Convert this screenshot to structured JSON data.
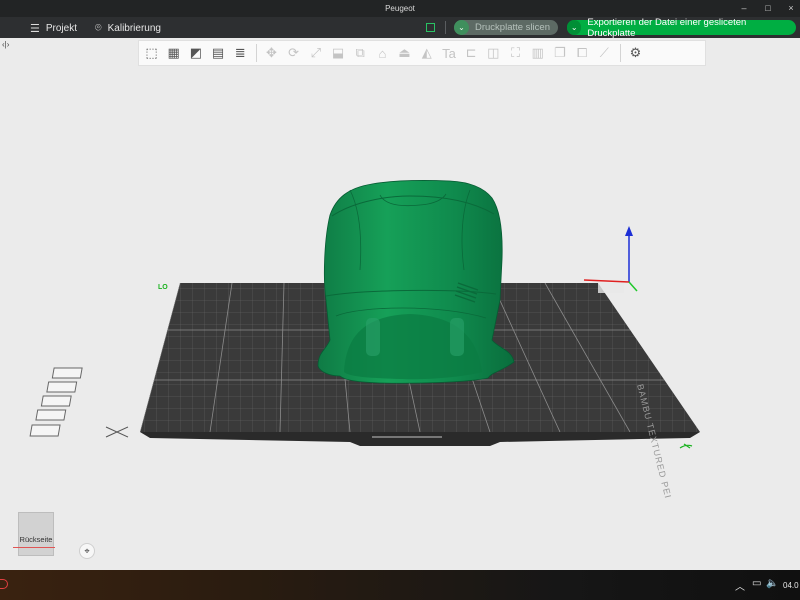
{
  "window": {
    "title": "Peugeot",
    "controls": [
      "minimize",
      "maximize",
      "close"
    ]
  },
  "menu": {
    "project_label": "Projekt",
    "calibration_label": "Kalibrierung"
  },
  "actions": {
    "slice_label": "Druckplatte slicen",
    "export_label": "Exportieren der Datei einer gesliceten Druckplatte"
  },
  "toolbar": {
    "tools": [
      "add-object-icon",
      "grid-arrange-icon",
      "orient-icon",
      "plate-icon",
      "layers-icon",
      "move-icon",
      "rotate-icon",
      "scale-icon",
      "lay-on-face-icon",
      "cut-icon",
      "support-paint-icon",
      "seam-paint-icon",
      "color-paint-icon",
      "text-icon",
      "measure-icon",
      "assembly-icon",
      "mesh-boolean-icon",
      "variable-layer-icon",
      "split-objects-icon",
      "split-parts-icon",
      "ruler-icon",
      "settings-icon"
    ]
  },
  "viewport": {
    "plate_label": "BAMBU TEXTURED PEI",
    "plate_corner_mark": "LO",
    "model_color": "#0b8a4e",
    "plate_color": "#3a3a3a",
    "view_cube_label": "Rückseite"
  },
  "colors": {
    "accent": "#00ae42",
    "axis_x": "#e02020",
    "axis_y": "#1fc82a",
    "axis_z": "#1d2fd6"
  },
  "taskbar": {
    "clock_text": "04.0"
  }
}
